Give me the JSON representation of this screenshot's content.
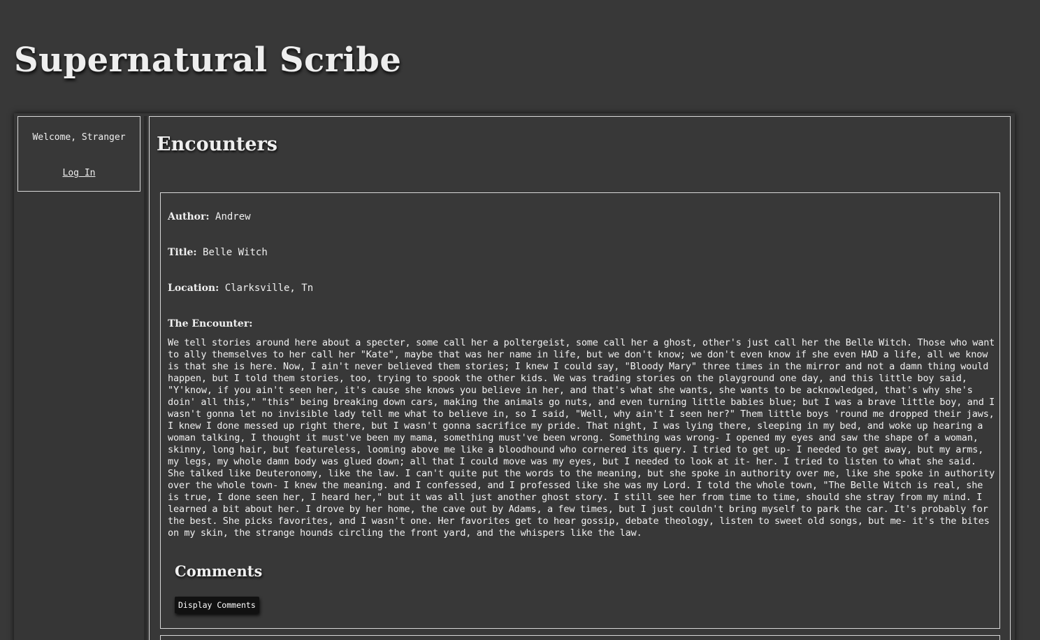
{
  "header": {
    "site_title": "Supernatural Scribe"
  },
  "sidebar": {
    "welcome_text": "Welcome, Stranger",
    "login_label": "Log In"
  },
  "main": {
    "section_title": "Encounters",
    "post": {
      "author_label": "Author:",
      "author": "Andrew",
      "title_label": "Title:",
      "title": "Belle Witch",
      "location_label": "Location:",
      "location": "Clarksville, Tn",
      "encounter_label": "The Encounter:",
      "encounter_text": "We tell stories around here about a specter, some call her a poltergeist, some call her a ghost, other's just call her the Belle Witch. Those who want to ally themselves to her call her \"Kate\", maybe that was her name in life, but we don't know; we don't even know if she even HAD a life, all we know is that she is here. Now, I ain't never believed them stories; I knew I could say, \"Bloody Mary\" three times in the mirror and not a damn thing would happen, but I told them stories, too, trying to spook the other kids. We was trading stories on the playground one day, and this little boy said, \"Y'know, if you ain't seen her, it's cause she knows you believe in her, and that's what she wants, she wants to be acknowledged, that's why she's doin' all this,\" \"this\" being breaking down cars, making the animals go nuts, and even turning little babies blue; but I was a brave little boy, and I wasn't gonna let no invisible lady tell me what to believe in, so I said, \"Well, why ain't I seen her?\" Them little boys 'round me dropped their jaws, I knew I done messed up right there, but I wasn't gonna sacrifice my pride. That night, I was lying there, sleeping in my bed, and woke up hearing a woman talking, I thought it must've been my mama, something must've been wrong. Something was wrong- I opened my eyes and saw the shape of a woman, skinny, long hair, but featureless, looming above me like a bloodhound who cornered its query. I tried to get up- I needed to get away, but my arms, my legs, my whole damn body was glued down; all that I could move was my eyes, but I needed to look at it- her. I tried to listen to what she said. She talked like Deuteronomy, like the law. I can't quite put the words to the meaning, but she spoke in authority over me, like she spoke in authority over the whole town- I knew the meaning. and I confessed, and I professed like she was my Lord. I told the whole town, \"The Belle Witch is real, she is true, I done seen her, I heard her,\" but it was all just another ghost story. I still see her from time to time, should she stray from my mind. I learned a bit about her. I drove by her home, the cave out by Adams, a few times, but I just couldn't bring myself to park the car. It's probably for the best. She picks favorites, and I wasn't one. Her favorites get to hear gossip, debate theology, listen to sweet old songs, but me- it's the bites on my skin, the strange hounds circling the front yard, and the whispers like the law.",
      "comments_heading": "Comments",
      "display_comments_label": "Display Comments"
    }
  }
}
